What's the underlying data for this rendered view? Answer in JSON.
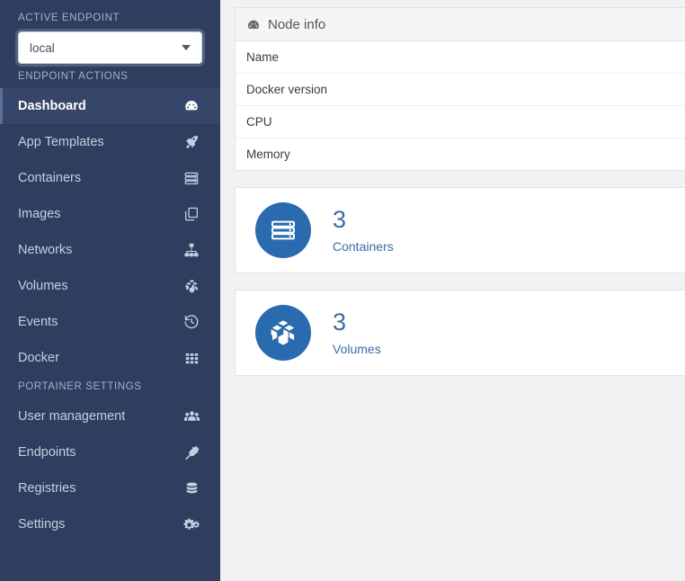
{
  "sidebar": {
    "active_endpoint_heading": "ACTIVE ENDPOINT",
    "endpoint_select": {
      "value": "local",
      "options": [
        "local"
      ]
    },
    "endpoint_actions_heading": "ENDPOINT ACTIONS",
    "endpoint_items": [
      {
        "label": "Dashboard",
        "icon": "gauge-icon",
        "active": true
      },
      {
        "label": "App Templates",
        "icon": "rocket-icon",
        "active": false
      },
      {
        "label": "Containers",
        "icon": "server-icon",
        "active": false
      },
      {
        "label": "Images",
        "icon": "copy-icon",
        "active": false
      },
      {
        "label": "Networks",
        "icon": "sitemap-icon",
        "active": false
      },
      {
        "label": "Volumes",
        "icon": "cubes-icon",
        "active": false
      },
      {
        "label": "Events",
        "icon": "history-icon",
        "active": false
      },
      {
        "label": "Docker",
        "icon": "grid-icon",
        "active": false
      }
    ],
    "portainer_settings_heading": "PORTAINER SETTINGS",
    "settings_items": [
      {
        "label": "User management",
        "icon": "users-icon",
        "active": false
      },
      {
        "label": "Endpoints",
        "icon": "plug-icon",
        "active": false
      },
      {
        "label": "Registries",
        "icon": "database-icon",
        "active": false
      },
      {
        "label": "Settings",
        "icon": "cogs-icon",
        "active": false
      }
    ]
  },
  "main": {
    "node_info": {
      "title": "Node info",
      "icon": "gauge-icon",
      "rows": [
        {
          "label": "Name",
          "value": ""
        },
        {
          "label": "Docker version",
          "value": ""
        },
        {
          "label": "CPU",
          "value": ""
        },
        {
          "label": "Memory",
          "value": ""
        }
      ]
    },
    "stats": [
      {
        "value": "3",
        "label": "Containers",
        "icon": "server-icon",
        "color": "#2a6bb0"
      },
      {
        "value": "3",
        "label": "Volumes",
        "icon": "cubes-icon",
        "color": "#2a6bb0"
      }
    ]
  },
  "colors": {
    "sidebar_bg": "#2f3e5e",
    "sidebar_active_bg": "#36456a",
    "accent_blue": "#2a6bb0",
    "stat_text_blue": "#3a6ea5",
    "page_bg": "#f2f2f2"
  }
}
